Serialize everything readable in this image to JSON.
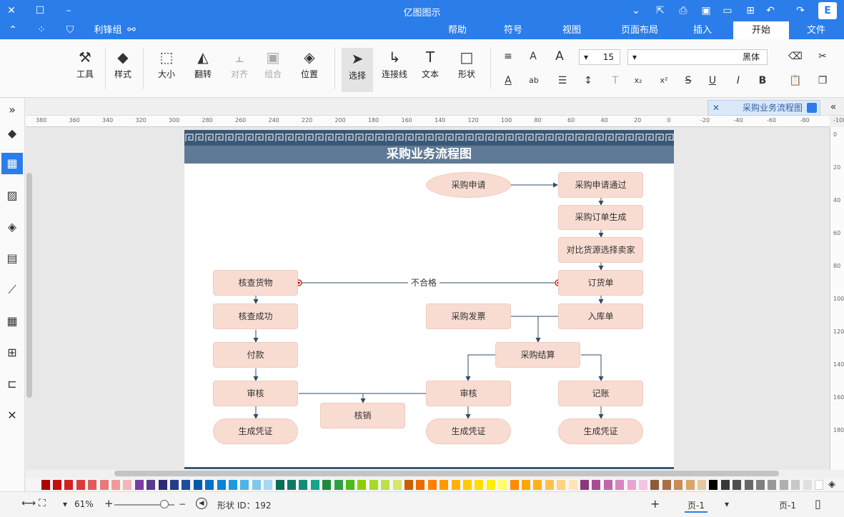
{
  "app": {
    "title": "亿图图示",
    "logo": "E"
  },
  "titlebar_icons": [
    "restore-icon",
    "user-icon",
    "share-icon",
    "print-icon",
    "save-icon",
    "folder-icon",
    "new-icon",
    "undo-icon",
    "redo-icon"
  ],
  "menu": {
    "tabs": [
      "文件",
      "开始",
      "插入",
      "页面布局",
      "视图",
      "符号",
      "帮助"
    ],
    "active": "开始",
    "quick": {
      "theme": "主题",
      "theme_label": "利锋组"
    }
  },
  "ribbon": {
    "font_name": "黑体",
    "font_size": "15",
    "big_buttons": [
      {
        "label": "形状",
        "icon": "□"
      },
      {
        "label": "文本",
        "icon": "T"
      },
      {
        "label": "连接线",
        "icon": "↳"
      },
      {
        "label": "选择",
        "icon": "➤"
      },
      {
        "label": "位置",
        "icon": "◈"
      },
      {
        "label": "组合",
        "icon": "▣"
      },
      {
        "label": "对齐",
        "icon": "⫠"
      },
      {
        "label": "翻转",
        "icon": "◭"
      },
      {
        "label": "大小",
        "icon": "⬚"
      },
      {
        "label": "样式",
        "icon": "◆"
      },
      {
        "label": "工具",
        "icon": "⚒"
      }
    ]
  },
  "document": {
    "tab_title": "采购业务流程图",
    "page_title": "采购业务流程图"
  },
  "ruler": {
    "h_ticks": [
      "380",
      "360",
      "340",
      "320",
      "300",
      "280",
      "260",
      "240",
      "220",
      "200",
      "180",
      "160",
      "140",
      "120",
      "100",
      "80",
      "60",
      "40",
      "20",
      "0",
      "-20",
      "-40",
      "-60",
      "-80",
      "-100"
    ],
    "v_ticks": [
      "0",
      "20",
      "40",
      "60",
      "80",
      "100",
      "120",
      "140",
      "160",
      "180"
    ]
  },
  "flow": {
    "nodes": {
      "n1": "采购申请",
      "n2": "采购申请通过",
      "n3": "采购订单生成",
      "n4": "对比货源选择卖家",
      "n5": "订货单",
      "n6": "核查货物",
      "n7": "入库单",
      "n8": "采购发票",
      "n9": "核查成功",
      "n10": "采购结算",
      "n11": "付款",
      "n12": "审核",
      "n13": "审核",
      "n14": "记账",
      "n15": "核销",
      "n16": "生成凭证",
      "n17": "生成凭证",
      "n18": "生成凭证"
    },
    "edge_label": "不合格"
  },
  "palette": [
    "#ffffff",
    "#e0e0e0",
    "#c8c8c8",
    "#b0b0b0",
    "#989898",
    "#808080",
    "#686868",
    "#505050",
    "#383838",
    "#000000",
    "#e6c7a3",
    "#d9a66b",
    "#c98d5a",
    "#a86f47",
    "#8d5a3a",
    "#f3c5e0",
    "#e7a6cf",
    "#d486bd",
    "#c067ab",
    "#a84b94",
    "#8a3a7a",
    "#ffe4b5",
    "#ffd280",
    "#ffc14d",
    "#ffb01a",
    "#ffa500",
    "#ff8c00",
    "#ffff66",
    "#ffee00",
    "#ffdd00",
    "#ffcc00",
    "#ffb300",
    "#ff9900",
    "#ff8000",
    "#e66c00",
    "#cc5f00",
    "#d4e76b",
    "#bde04a",
    "#a6d92a",
    "#8fce00",
    "#4cbb17",
    "#2e9e44",
    "#1f8a3a",
    "#17a589",
    "#138d75",
    "#0e7a66",
    "#0b6b58",
    "#a8d8f0",
    "#7ec8ec",
    "#4fb3e8",
    "#1e9be0",
    "#0a84d6",
    "#0071c5",
    "#005ba8",
    "#1f4e9a",
    "#273c8a",
    "#2d2a7a",
    "#5b3b8c",
    "#7a3ea3",
    "#f2b6b6",
    "#ee9a9a",
    "#e87a7a",
    "#e35a5a",
    "#dd3a3a",
    "#d42020",
    "#c41010",
    "#b00000"
  ],
  "status": {
    "page_label": "页-1",
    "page_tab": "页-1",
    "add_page": "+",
    "shape_id": "形状 ID：192",
    "zoom": "61%"
  },
  "sidebar_icons": [
    "expand-icon",
    "fill-icon",
    "grid-icon",
    "image-icon",
    "layers-icon",
    "document-icon",
    "chart-icon",
    "table-icon",
    "org-icon",
    "format-icon",
    "shuffle-icon"
  ]
}
